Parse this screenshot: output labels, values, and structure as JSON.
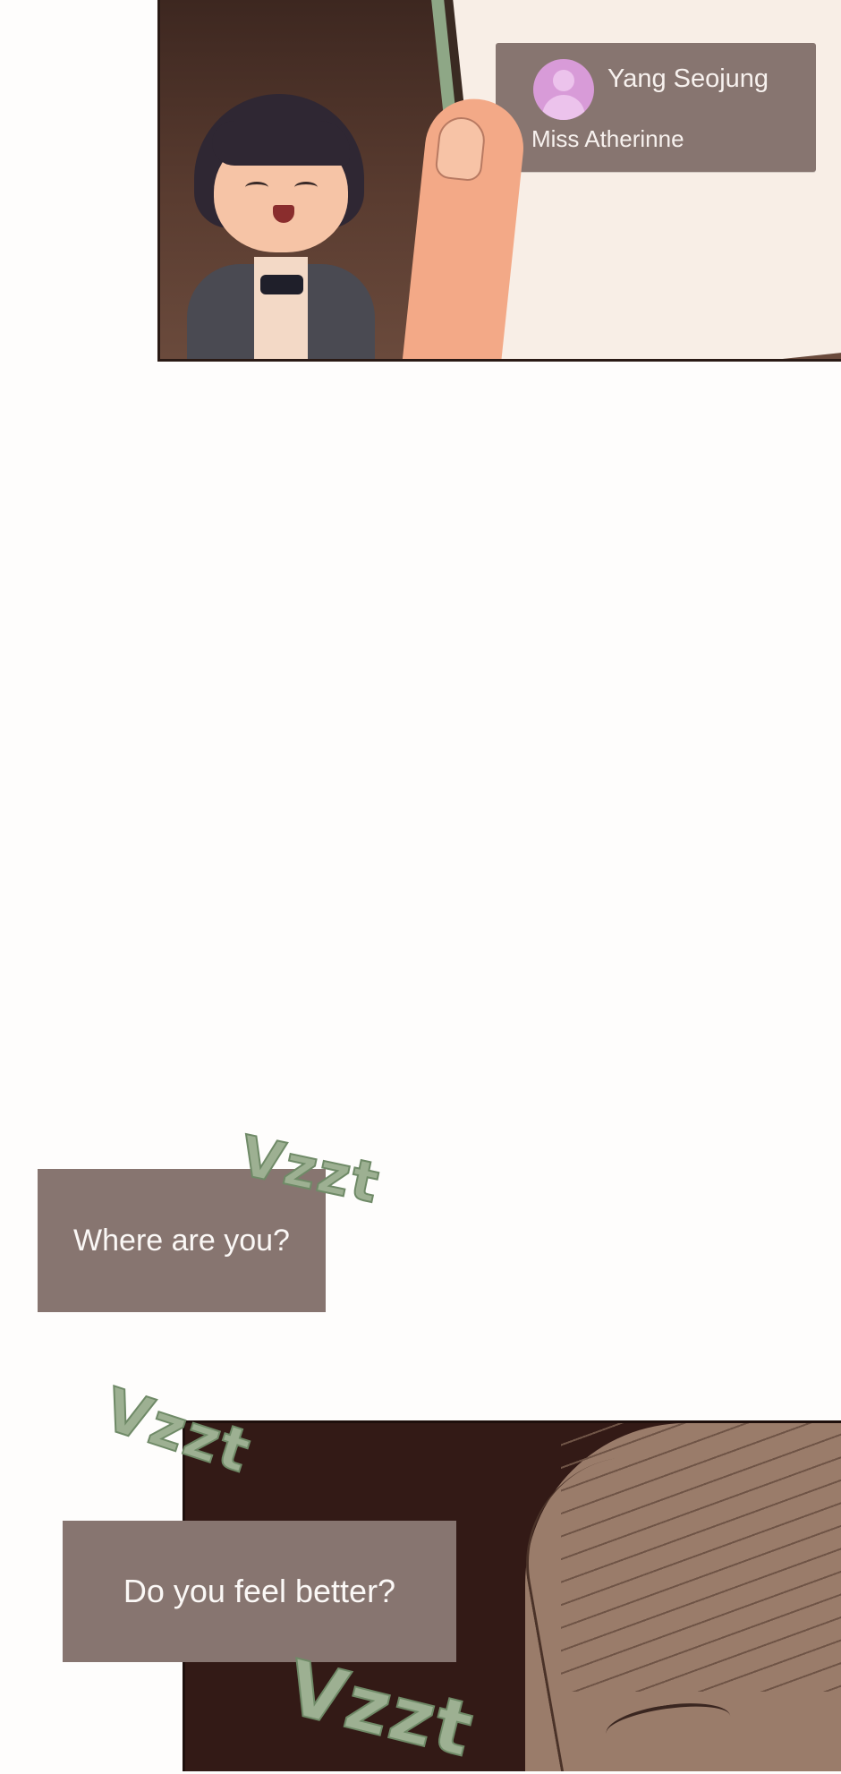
{
  "top_panel": {
    "incoming_call": {
      "caller_name": "Yang Seojung",
      "caller_subtitle": "Miss Atherinne",
      "avatar_icon": "person-silhouette-icon",
      "avatar_color": "#d89bd8",
      "banner_color": "#877570"
    },
    "phone_frame_color": "#8ea786"
  },
  "dialogue": {
    "bubble_1": "Where are you?",
    "bubble_2": "Do you feel better?",
    "bubble_color": "#877570"
  },
  "sound_effects": [
    "Vzzt",
    "Vzzt",
    "Vzzt"
  ],
  "sfx_color": "#9db092"
}
